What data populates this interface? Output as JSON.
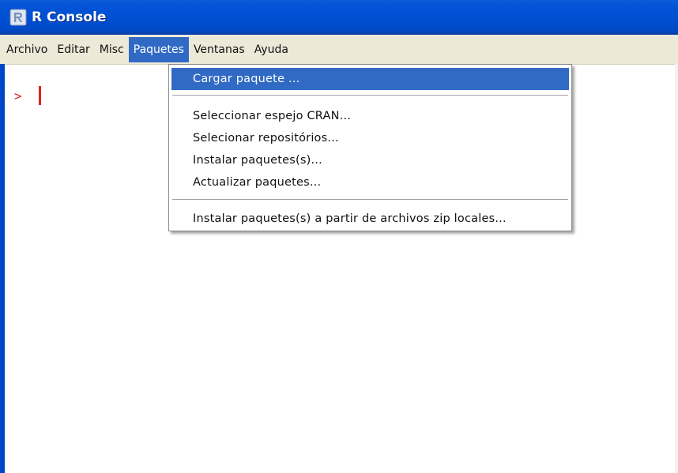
{
  "window": {
    "title": "R Console",
    "icon": "r-logo-icon"
  },
  "menubar": {
    "items": [
      {
        "label": "Archivo"
      },
      {
        "label": "Editar"
      },
      {
        "label": "Misc"
      },
      {
        "label": "Paquetes",
        "active": true
      },
      {
        "label": "Ventanas"
      },
      {
        "label": "Ayuda"
      }
    ]
  },
  "dropdown": {
    "items": [
      {
        "label": "Cargar paquete ...",
        "selected": true
      },
      {
        "label": "Seleccionar espejo CRAN..."
      },
      {
        "label": "Selecionar repositórios..."
      },
      {
        "label": "Instalar paquetes(s)..."
      },
      {
        "label": "Actualizar paquetes..."
      },
      {
        "label": "Instalar paquetes(s) a partir de archivos zip locales..."
      }
    ]
  },
  "console": {
    "prompt": ">"
  },
  "colors": {
    "titlebar": "#0050d4",
    "menu_highlight": "#316ac5",
    "menubar_bg": "#ece9d8",
    "prompt": "#e02020"
  }
}
